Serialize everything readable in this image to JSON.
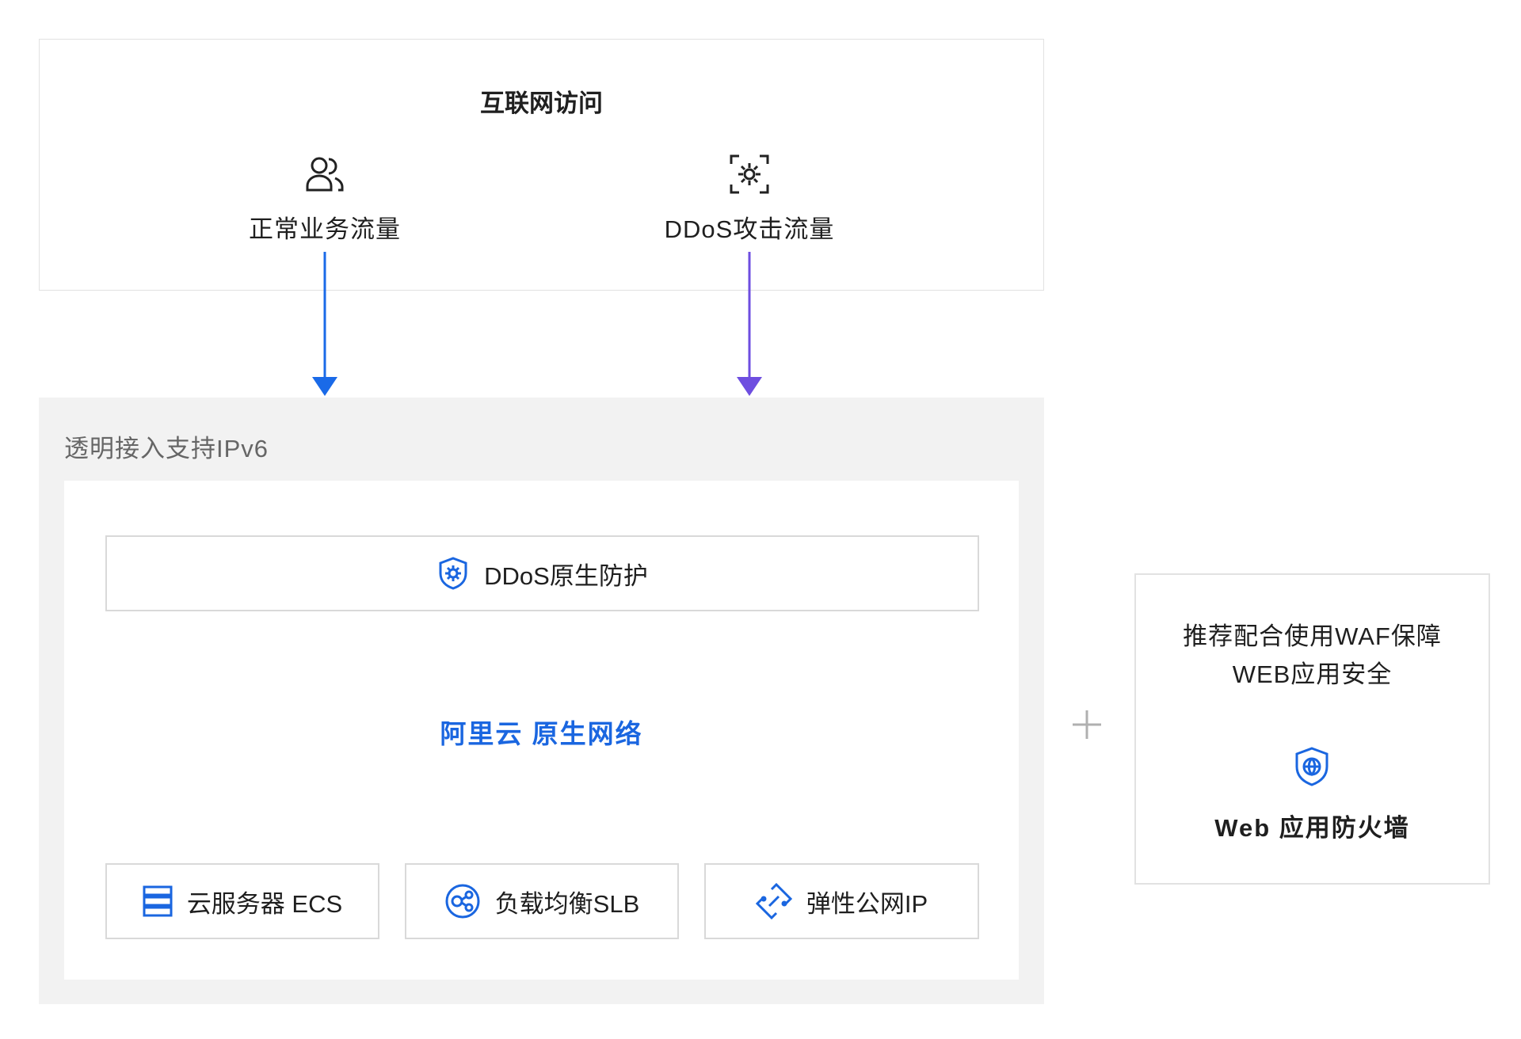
{
  "internet": {
    "title": "互联网访问",
    "normal_label": "正常业务流量",
    "ddos_label": "DDoS攻击流量"
  },
  "outer": {
    "label": "透明接入支持IPv6"
  },
  "protection": {
    "label": "DDoS原生防护"
  },
  "network": {
    "label": "阿里云 原生网络"
  },
  "services": [
    {
      "label": "云服务器 ECS",
      "icon": "server-icon"
    },
    {
      "label": "负载均衡SLB",
      "icon": "load-balancer-icon"
    },
    {
      "label": "弹性公网IP",
      "icon": "link-icon"
    }
  ],
  "waf": {
    "line1": "推荐配合使用WAF保障",
    "line2": "WEB应用安全",
    "title": "Web 应用防火墙"
  },
  "colors": {
    "normal_arrow": "#1a6ae8",
    "ddos_arrow": "#6e4ee0",
    "accent_text": "#1a66e0",
    "outer_bg": "#f2f2f2"
  }
}
